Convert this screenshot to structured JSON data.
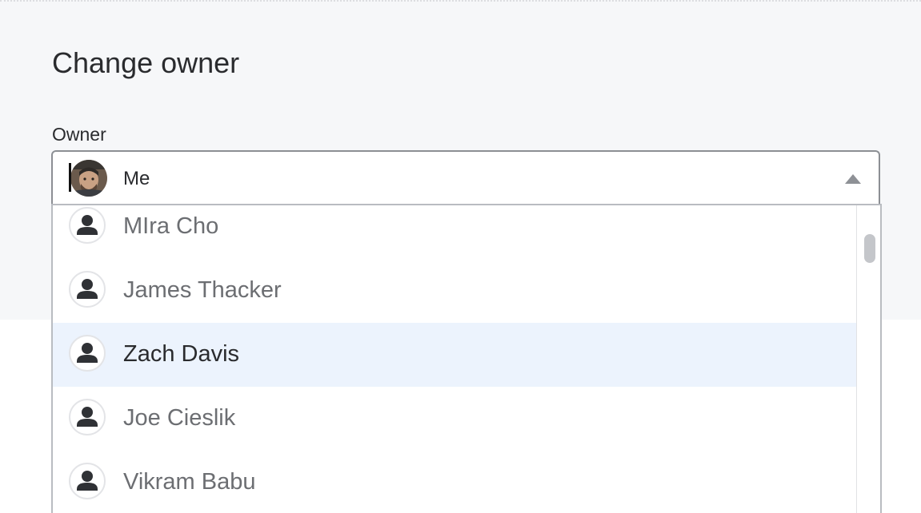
{
  "dialog": {
    "title": "Change owner",
    "owner_label": "Owner"
  },
  "select": {
    "value": "Me",
    "avatar_icon": "user-photo-avatar",
    "chevron_icon": "chevron-up-icon"
  },
  "options": [
    {
      "name": "MIra Cho",
      "icon": "person-icon"
    },
    {
      "name": "James Thacker",
      "icon": "person-icon"
    },
    {
      "name": "Zach Davis",
      "icon": "person-icon",
      "highlighted": true
    },
    {
      "name": "Joe Cieslik",
      "icon": "person-icon"
    },
    {
      "name": "Vikram Babu",
      "icon": "person-icon"
    }
  ],
  "colors": {
    "panel_background": "#f6f7f9",
    "highlight_background": "#ecf3fd",
    "text_primary": "#2a2b2e",
    "text_secondary": "#6c6e72",
    "person_icon": "#2f3135"
  }
}
